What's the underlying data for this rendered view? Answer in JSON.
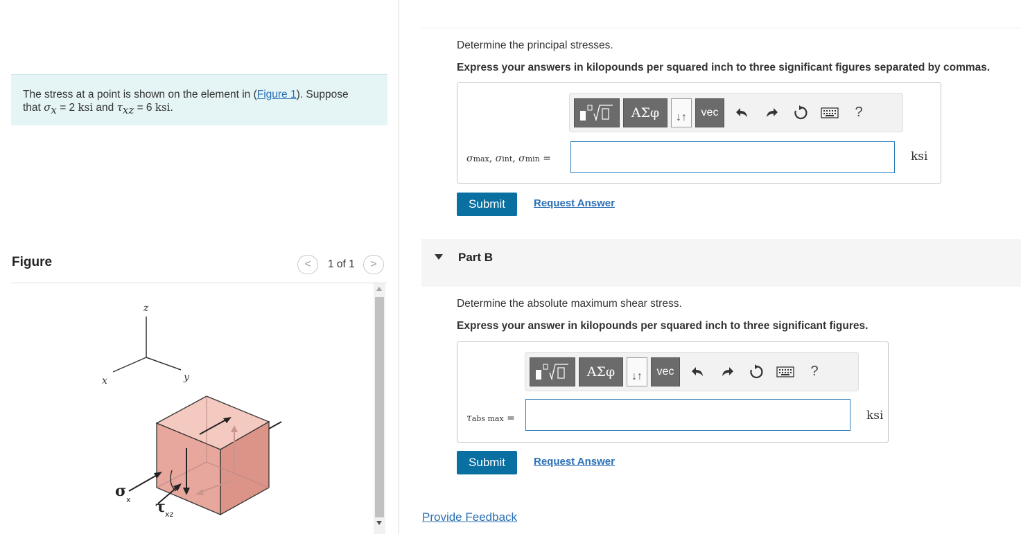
{
  "problem": {
    "text_before_link": "The stress at a point is shown on the element in (",
    "link_text": "Figure 1",
    "text_after_link": "). Suppose",
    "line2_that": "that",
    "sigma_symbol": "σ",
    "sigma_sub": "x",
    "eq1": " = 2",
    "unit1": "ksi",
    "and_text": " and ",
    "tau_symbol": "τ",
    "tau_sub": "xz",
    "eq2": " = 6",
    "unit2": "ksi",
    "end": "."
  },
  "figure": {
    "title": "Figure",
    "prev": "<",
    "page": "1 of 1",
    "next": ">",
    "axis_z": "z",
    "axis_x": "x",
    "axis_y": "y",
    "sigma_label": "σ",
    "sigma_sub": "x",
    "tau_label": "τ",
    "tau_sub": "xz"
  },
  "toolbar": {
    "greek": "ΑΣφ",
    "arrows": "↓↑",
    "vec": "vec",
    "help": "?"
  },
  "partA": {
    "prompt": "Determine the principal stresses.",
    "instruction": "Express your answers in kilopounds per squared inch to three significant figures separated by commas.",
    "sigma": "σ",
    "sub_max": "max",
    "sub_int": "int",
    "sub_min": "min",
    "sep": ", ",
    "equals": " =",
    "input_value": "",
    "unit": "ksi",
    "submit": "Submit",
    "request": "Request Answer"
  },
  "partB": {
    "title": "Part B",
    "prompt": "Determine the absolute maximum shear stress.",
    "instruction": "Express your answer in kilopounds per squared inch to three significant figures.",
    "tau": "τ",
    "sub": "abs max",
    "equals": " =",
    "input_value": "",
    "unit": "ksi",
    "submit": "Submit",
    "request": "Request Answer"
  },
  "feedback": "Provide Feedback",
  "colors": {
    "accent": "#0a6fa1",
    "link": "#2a6fb5",
    "problem_bg": "#e5f4f5",
    "cube_front": "#e8a49a",
    "cube_top": "#f4c9bf",
    "cube_side": "#d98d83"
  }
}
